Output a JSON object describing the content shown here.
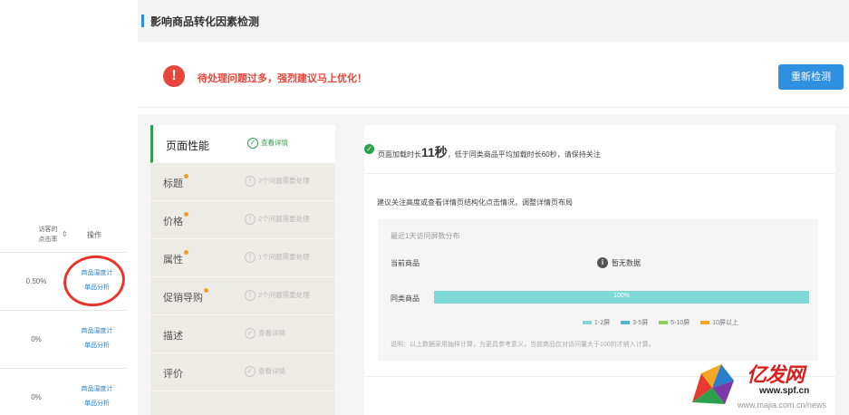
{
  "left_table": {
    "col_rate_header": "访客的\n点击率",
    "col_op_header": "操作",
    "rows": [
      {
        "rate": "0.50%",
        "link1": "商品温度计",
        "link2": "单品分析"
      },
      {
        "rate": "0%",
        "link1": "商品温度计",
        "link2": "单品分析"
      },
      {
        "rate": "0%",
        "link1": "商品温度计",
        "link2": "单品分析"
      }
    ]
  },
  "header": {
    "title": "影响商品转化因素检测"
  },
  "alert": {
    "icon": "!",
    "message": "待处理问题过多，强烈建议马上优化！",
    "recheck_label": "重新检测"
  },
  "menu": [
    {
      "label": "页面性能",
      "status": "查看详情",
      "icon": "✓",
      "active": true,
      "dot": false
    },
    {
      "label": "标题",
      "status": "2个问题需要处理",
      "icon": "!",
      "active": false,
      "dot": true
    },
    {
      "label": "价格",
      "status": "2个问题需要处理",
      "icon": "!",
      "active": false,
      "dot": true
    },
    {
      "label": "属性",
      "status": "1个问题需要处理",
      "icon": "!",
      "active": false,
      "dot": true
    },
    {
      "label": "促销导购",
      "status": "2个问题需要处理",
      "icon": "!",
      "active": false,
      "dot": true
    },
    {
      "label": "描述",
      "status": "查看详情",
      "icon": "✓",
      "active": false,
      "dot": false
    },
    {
      "label": "评价",
      "status": "查看详情",
      "icon": "✓",
      "active": false,
      "dot": false
    }
  ],
  "content": {
    "load_prefix": "页面加载时长",
    "load_value": "11秒",
    "load_suffix": "，低于同类商品平均加载时长60秒，请保持关注",
    "advice": "建议关注高度或查看详情页结构化点击情况，调整详情页布局",
    "dist_title": "最近1天访问屏数分布",
    "current_label": "当前商品",
    "no_data": "暂无数据",
    "similar_label": "同类商品",
    "similar_bar_value": 1.0,
    "similar_bar_label": "100%",
    "legend": [
      {
        "label": "1-2屏",
        "color": "#7fd8d8"
      },
      {
        "label": "3-5屏",
        "color": "#4fb8c0"
      },
      {
        "label": "5-10屏",
        "color": "#8fcf5a"
      },
      {
        "label": "10屏以上",
        "color": "#f6a524"
      }
    ],
    "note": "说明：以上数据采用抽样计算，为更具参考意义，当前商品仅对访问量大于100的才纳入计算。"
  },
  "watermark": {
    "brand": "亿发网",
    "url1": "www.spf.cn",
    "url2": "www.majia.com.cn/news"
  }
}
